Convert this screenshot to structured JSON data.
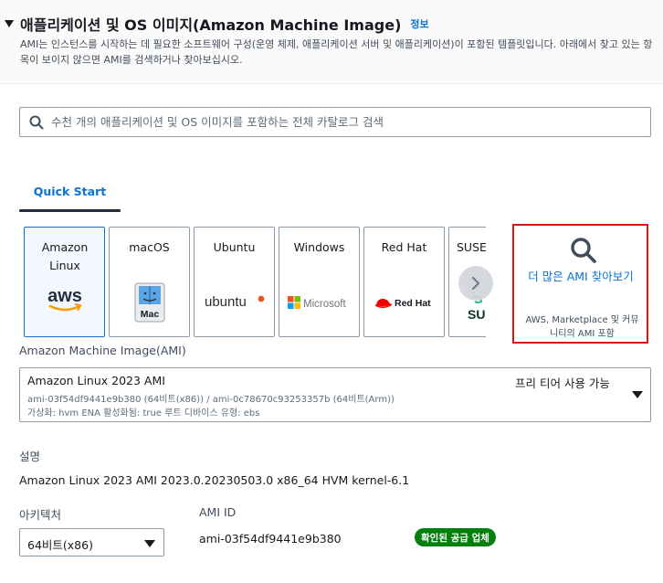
{
  "section": {
    "title": "애플리케이션 및 OS 이미지(Amazon Machine Image)",
    "info_link": "정보",
    "description": "AMI는 인스턴스를 시작하는 데 필요한 소프트웨어 구성(운영 체제, 애플리케이션 서버 및 애플리케이션)이 포함된 템플릿입니다. 아래에서 찾고 있는 항목이 보이지 않으면 AMI를 검색하거나 찾아보십시오."
  },
  "search": {
    "placeholder": "수천 개의 애플리케이션 및 OS 이미지를 포함하는 전체 카탈로그 검색"
  },
  "tabs": [
    {
      "label": "Quick Start",
      "active": true
    }
  ],
  "os_tiles": [
    {
      "label": "Amazon Linux",
      "logo": "aws",
      "selected": true
    },
    {
      "label": "macOS",
      "logo": "Mac",
      "selected": false
    },
    {
      "label": "Ubuntu",
      "logo": "ubuntu",
      "selected": false
    },
    {
      "label": "Windows",
      "logo": "Microsoft",
      "selected": false
    },
    {
      "label": "Red Hat",
      "logo": "Red Hat",
      "selected": false
    },
    {
      "label": "SUSE",
      "logo": "SU",
      "selected": false
    }
  ],
  "browse_more": {
    "label": "더 많은 AMI 찾아보기",
    "sublabel": "AWS, Marketplace 및 커뮤니티의 AMI 포함"
  },
  "ami_field": {
    "label": "Amazon Machine Image(AMI)",
    "selected_name": "Amazon Linux 2023 AMI",
    "ids_line": "ami-03f54df9441e9b380 (64비트(x86)) / ami-0c78670c93253357b (64비트(Arm))",
    "props_line": "가상화: hvm    ENA 활성화됨: true    루트 디바이스 유형: ebs",
    "free_tier": "프리 티어 사용 가능"
  },
  "description_field": {
    "label": "설명",
    "value": "Amazon Linux 2023 AMI 2023.0.20230503.0 x86_64 HVM kernel-6.1"
  },
  "architecture_field": {
    "label": "아키텍처",
    "value": "64비트(x86)"
  },
  "ami_id_field": {
    "label": "AMI ID",
    "value": "ami-03f54df9441e9b380",
    "badge": "확인된 공급 업체"
  },
  "colors": {
    "link_blue": "#0972d3",
    "highlight_red": "#d91515",
    "badge_green": "#037f0c",
    "selected_tile_bg": "#f2f8fd"
  }
}
